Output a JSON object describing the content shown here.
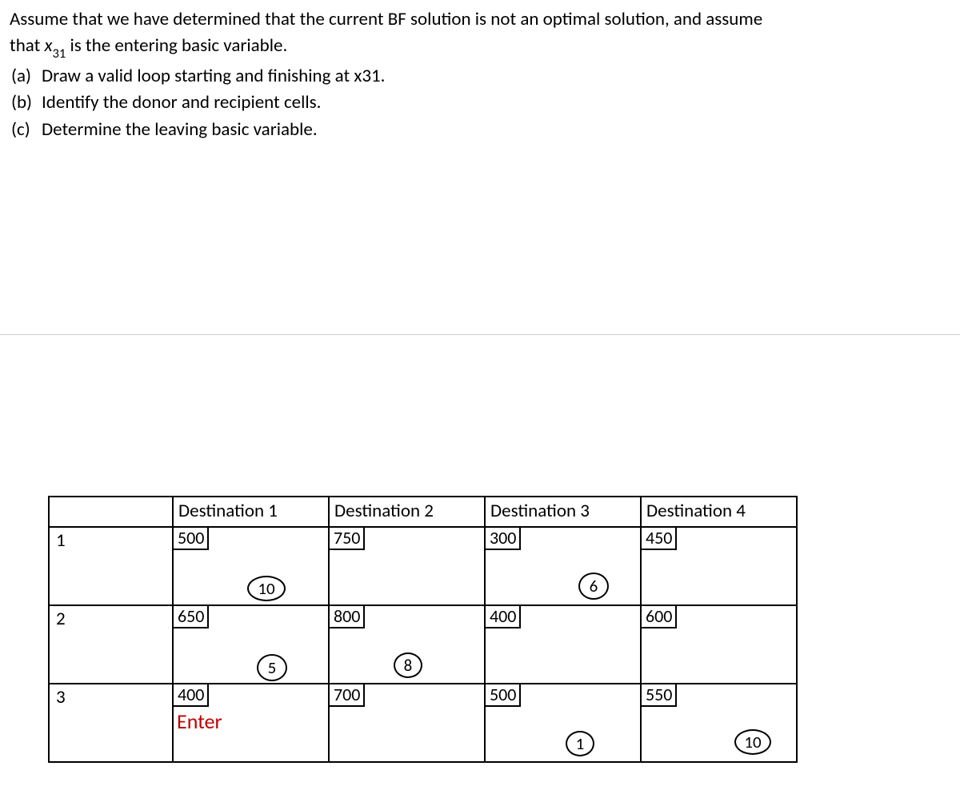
{
  "intro": {
    "line1_a": "Assume that we have determined that the current BF solution is not an optimal solution, and assume",
    "line2_a": "that ",
    "var_x": "x",
    "var_sub": "31",
    "line2_b": " is the entering basic variable."
  },
  "parts": {
    "a_label": "(a)",
    "a_text_1": "Draw a valid loop starting and finishing at ",
    "a_var_x": "x",
    "a_var_sub": "31",
    "a_text_2": ".",
    "b_label": "(b)",
    "b_text": "Identify the donor and recipient cells.",
    "c_label": "(c)",
    "c_text": "Determine the leaving basic variable."
  },
  "table": {
    "headers": {
      "d1": "Destination 1",
      "d2": "Destination  2",
      "d3": "Destination  3",
      "d4": "Destination 4"
    },
    "row_labels": {
      "r1": "1",
      "r2": "2",
      "r3": "3"
    },
    "costs": {
      "r1d1": "500",
      "r1d2": "750",
      "r1d3": "300",
      "r1d4": "450",
      "r2d1": "650",
      "r2d2": "800",
      "r2d3": "400",
      "r2d4": "600",
      "r3d1": "400",
      "r3d2": "700",
      "r3d3": "500",
      "r3d4": "550"
    },
    "alloc": {
      "r1d1": "10",
      "r1d3": "6",
      "r2d1": "5",
      "r2d2": "8",
      "r3d3": "1",
      "r3d4": "10"
    },
    "enter_label": "Enter"
  }
}
